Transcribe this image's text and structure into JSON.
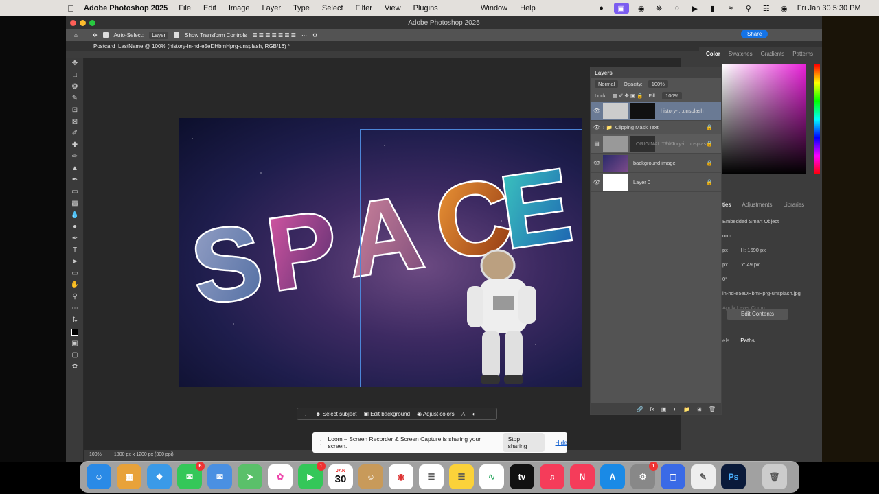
{
  "menubar": {
    "app_name": "Adobe Photoshop 2025",
    "items": [
      "File",
      "Edit",
      "Image",
      "Layer",
      "Type",
      "Select",
      "Filter",
      "View",
      "Plugins",
      "Window",
      "Help"
    ],
    "clock": "Fri Jan 30  5:30 PM"
  },
  "window": {
    "title": "Adobe Photoshop 2025",
    "document_tab": "Postcard_LastName @ 100% (history-in-hd-e5eDHbmHprg-unsplash, RGB/16) *"
  },
  "options": {
    "auto_select": "Auto-Select:",
    "layer_select": "Layer",
    "transform_controls": "Show Transform Controls",
    "share": "Share"
  },
  "artwork": {
    "word": "SPACE"
  },
  "context_bar": {
    "select_subject": "Select subject",
    "edit_background": "Edit background",
    "adjust_colors": "Adjust colors"
  },
  "status": {
    "zoom": "100%",
    "doc_size": "1800 px x 1200 px (300 ppi)"
  },
  "loom": {
    "message": "Loom – Screen Recorder & Screen Capture is sharing your screen.",
    "stop": "Stop sharing",
    "hide": "Hide"
  },
  "layers_panel": {
    "title": "Layers",
    "blend_mode": "Normal",
    "opacity_label": "Opacity:",
    "opacity": "100%",
    "lock_label": "Lock:",
    "fill_label": "Fill:",
    "fill": "100%",
    "layers": [
      {
        "name": "history-i...unsplash"
      },
      {
        "name": "Clipping Mask Text"
      },
      {
        "name": "ORIGINAL TEXT"
      },
      {
        "name": "background image"
      },
      {
        "name": "Layer 0"
      }
    ],
    "dragging_label": "history-i...unsplash"
  },
  "right_panel": {
    "tabs": [
      "Color",
      "Swatches",
      "Gradients",
      "Patterns"
    ],
    "prop_tabs": [
      "ties",
      "Adjustments",
      "Libraries"
    ],
    "smart_object": "Embedded Smart Object",
    "section": "orm",
    "h_label": "H:",
    "h_value": "1690 px",
    "y_label": "Y:",
    "y_value": "49 px",
    "w_unit": "px",
    "x_unit": "px",
    "angle": "0°",
    "file": "in-hd-e5eDHbmHprg-unsplash.jpg",
    "apply_comp": "Apply Layer Comp",
    "edit_contents": "Edit Contents",
    "path_tabs": [
      "els",
      "Paths"
    ]
  },
  "dock": {
    "calendar_month": "JAN",
    "calendar_day": "30",
    "badges": {
      "messages": "6",
      "facetime": "1",
      "settings": "1"
    }
  },
  "colors": {
    "accent": "#1473e6",
    "selected_layer": "#6a7a94"
  }
}
